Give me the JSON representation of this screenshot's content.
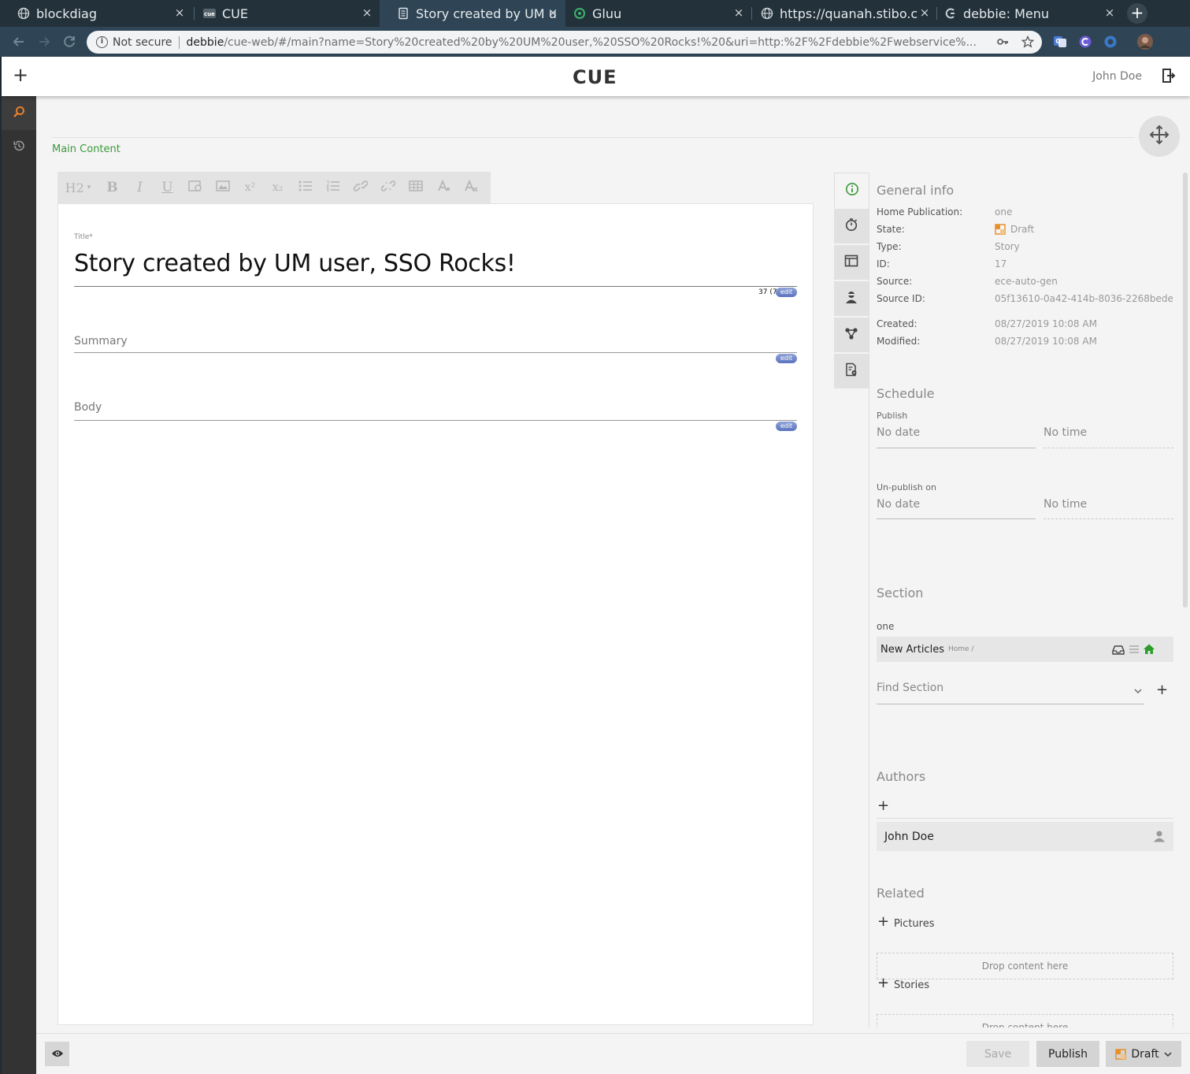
{
  "browser": {
    "tabs": [
      {
        "title": "blockdiag",
        "icon": "globe-icon"
      },
      {
        "title": "CUE",
        "icon": "cue-favicon-icon"
      },
      {
        "title": "Story created by UM u",
        "icon": "document-icon"
      },
      {
        "title": "Gluu",
        "icon": "gluu-icon"
      },
      {
        "title": "https://quanah.stibo.c",
        "icon": "globe-icon"
      },
      {
        "title": "debbie: Menu",
        "icon": "debbie-icon"
      }
    ],
    "active_tab_index": 2,
    "new_tab_label": "+",
    "close_glyph": "×",
    "omnibox": {
      "security_label": "Not secure",
      "host": "debbie",
      "path": "/cue-web/#/main?name=Story%20created%20by%20UM%20user,%20SSO%20Rocks!%20&uri=http:%2F%2Fdebbie%2Fwebservice%..."
    }
  },
  "app": {
    "logo_text": "CUE",
    "add_label": "+",
    "user_name": "John Doe",
    "main_content_label": "Main Content",
    "rte_buttons": [
      "H2",
      "B",
      "I",
      "U",
      "",
      "",
      "x²",
      "x₂",
      "",
      "",
      "",
      "",
      "",
      "",
      ""
    ],
    "title_field": {
      "label": "Title*",
      "value": "Story created by UM user, SSO Rocks!",
      "counter": "37 (7)",
      "edit_label": "edit"
    },
    "summary_field": {
      "placeholder": "Summary",
      "edit_label": "edit"
    },
    "body_field": {
      "placeholder": "Body",
      "edit_label": "edit"
    },
    "side_tabs": [
      "info-icon",
      "timer-icon",
      "layout-icon",
      "user-icon",
      "share-icon",
      "document-settings-icon"
    ],
    "general_info": {
      "title": "General info",
      "rows": [
        {
          "key": "Home Publication:",
          "value": "one"
        },
        {
          "key": "State:",
          "value": "Draft"
        },
        {
          "key": "Type:",
          "value": "Story"
        },
        {
          "key": "ID:",
          "value": "17"
        },
        {
          "key": "Source:",
          "value": "ece-auto-gen"
        },
        {
          "key": "Source ID:",
          "value": "05f13610-0a42-414b-8036-2268bede..."
        },
        {
          "key": "Created:",
          "value": "08/27/2019 10:08 AM"
        },
        {
          "key": "Modified:",
          "value": "08/27/2019 10:08 AM"
        }
      ]
    },
    "schedule": {
      "title": "Schedule",
      "publish_label": "Publish",
      "publish_date": "No date",
      "publish_time": "No time",
      "unpublish_label": "Un-publish on",
      "unpublish_date": "No date",
      "unpublish_time": "No time"
    },
    "section": {
      "title": "Section",
      "publication": "one",
      "row_name": "New Articles",
      "row_path": "Home /",
      "find_placeholder": "Find Section",
      "add_label": "+"
    },
    "authors": {
      "title": "Authors",
      "add_label": "+",
      "items": [
        "John Doe"
      ]
    },
    "related": {
      "title": "Related",
      "pictures_label": "Pictures",
      "stories_label": "Stories",
      "drop_text": "Drop content here",
      "add_label": "+"
    },
    "footer": {
      "save_label": "Save",
      "publish_label": "Publish",
      "state_label": "Draft"
    }
  },
  "colors": {
    "accent_green": "#3a9a3a",
    "draft_orange": "#e8902a",
    "rail_dark": "#333333",
    "search_orange": "#e87f2a"
  }
}
